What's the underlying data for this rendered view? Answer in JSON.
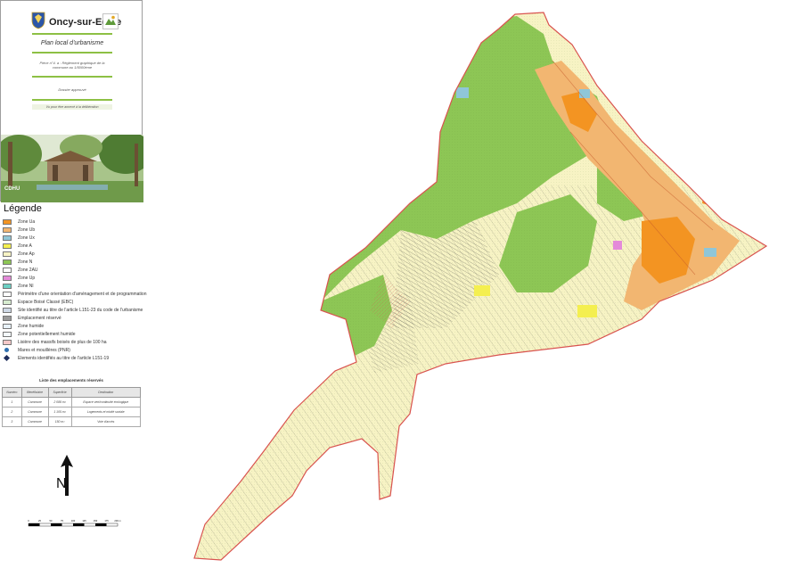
{
  "cartouche": {
    "town": "Oncy-sur-Ecole",
    "plu_title": "Plan local d'urbanisme",
    "piece_line1": "Pièce n°4. a : Règlement graphique de la",
    "piece_line2": "commune au 1/5000ème",
    "dossier": "Dossier approuvé",
    "vu_pour": "Vu pour être annexé à la délibération",
    "photo_credit": "CDHU"
  },
  "legend": {
    "title": "Légende",
    "items": [
      {
        "label": "Zone Ua",
        "color": "#f39422"
      },
      {
        "label": "Zone Ub",
        "color": "#f2b671"
      },
      {
        "label": "Zone Ux",
        "color": "#8fc6d8"
      },
      {
        "label": "Zone A",
        "color": "#f4ef4f"
      },
      {
        "label": "Zone Ap",
        "color": "#f7f3c4"
      },
      {
        "label": "Zone N",
        "color": "#8dc655"
      },
      {
        "label": "Zone 2AU",
        "color": "#ffffff"
      },
      {
        "label": "Zone Up",
        "color": "#e48ad9"
      },
      {
        "label": "Zone Nl",
        "color": "#6cd0c3"
      },
      {
        "label": "Périmètre d'une orientation d'aménagement et de programmation",
        "color": "#ffffff"
      },
      {
        "label": "Espace Boisé Classé (EBC)",
        "color": "#d7ecd0"
      },
      {
        "label": "Site identifié au titre de l'article L151-23 du code de l'urbanisme",
        "color": "#cfd9e6"
      },
      {
        "label": "Emplacement réservé",
        "color": "#9a9a9a"
      },
      {
        "label": "Zone humide",
        "color": "#e8f2fa"
      },
      {
        "label": "Zone potentiellement humide",
        "color": "#f4f9fd"
      },
      {
        "label": "Lisière des massifs boisés de plus de 100 ha",
        "color": "#f5c9c9"
      },
      {
        "label": "Mares et mouillères (PNR)",
        "color": "#2f6fb0"
      },
      {
        "label": "Elements identifiés au titre de l'article L151-19",
        "color": "#1f2e5c"
      }
    ]
  },
  "reserved": {
    "title": "Liste des emplacements réservés",
    "headers": [
      "Numéro",
      "Bénéficiaire",
      "Superficie",
      "Destination"
    ],
    "rows": [
      [
        "1",
        "Commune",
        "2 088 m²",
        "Espace vert/continuité écologique"
      ],
      [
        "2",
        "Commune",
        "1 105 m²",
        "Logements et mixité sociale"
      ],
      [
        "3",
        "Commune",
        "150 m²",
        "Voie d'accès"
      ]
    ]
  },
  "north_label": "N",
  "scale_ticks": [
    "0",
    "25",
    "50",
    "75",
    "100",
    "125",
    "150",
    "175",
    "200 m"
  ],
  "colors": {
    "zone_n": "#8dc655",
    "zone_ap": "#f7f3c4",
    "zone_ua": "#f39422",
    "zone_ub": "#f2b671",
    "zone_a": "#f4ef4f",
    "commune_border": "#d9534f"
  }
}
